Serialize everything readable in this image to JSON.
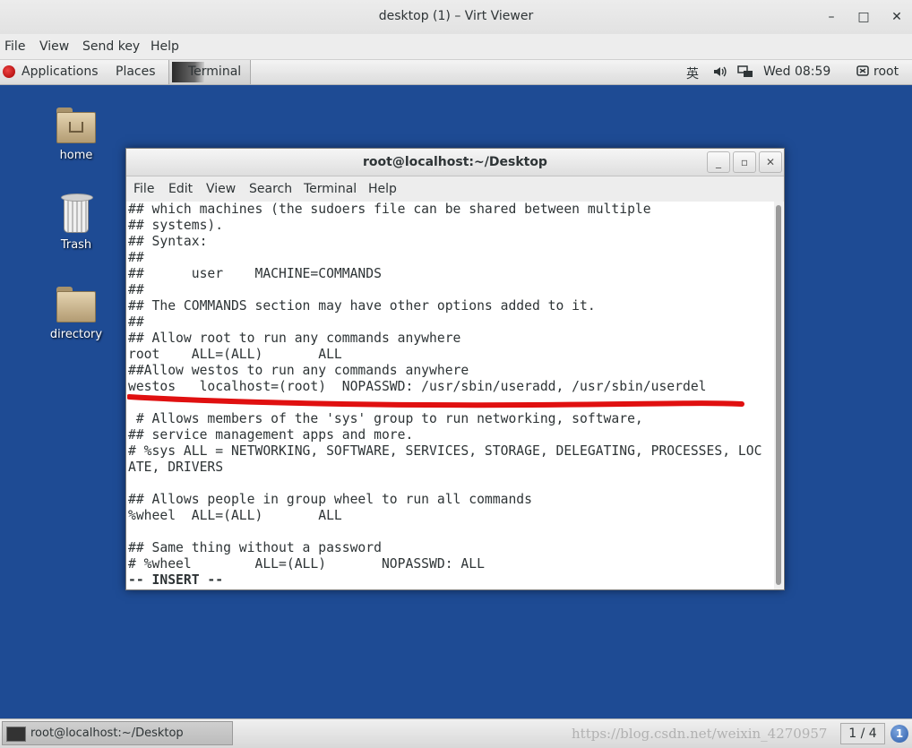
{
  "viewer": {
    "title": "desktop (1) – Virt Viewer",
    "controls": {
      "minimize": "–",
      "maximize": "□",
      "close": "✕"
    },
    "menu": [
      "File",
      "View",
      "Send key",
      "Help"
    ]
  },
  "top_panel": {
    "applications": "Applications",
    "places": "Places",
    "terminal": "Terminal",
    "input_method": "英",
    "volume_icon": "speaker-icon",
    "network_icon": "network-icon",
    "clock": "Wed 08:59",
    "user": "root"
  },
  "desktop": {
    "icons": [
      {
        "label": "home",
        "icon": "home-folder-icon"
      },
      {
        "label": "Trash",
        "icon": "trash-icon"
      },
      {
        "label": "directory",
        "icon": "folder-icon"
      }
    ]
  },
  "terminal": {
    "title": "root@localhost:~/Desktop",
    "controls": {
      "minimize": "_",
      "maximize": "▫",
      "close": "✕"
    },
    "menu": [
      "File",
      "Edit",
      "View",
      "Search",
      "Terminal",
      "Help"
    ],
    "lines": [
      "## which machines (the sudoers file can be shared between multiple",
      "## systems).",
      "## Syntax:",
      "##",
      "##      user    MACHINE=COMMANDS",
      "##",
      "## The COMMANDS section may have other options added to it.",
      "##",
      "## Allow root to run any commands anywhere",
      "root    ALL=(ALL)       ALL",
      "##Allow westos to run any commands anywhere",
      "westos   localhost=(root)  NOPASSWD: /usr/sbin/useradd, /usr/sbin/userdel",
      "",
      " # Allows members of the 'sys' group to run networking, software,",
      "## service management apps and more.",
      "# %sys ALL = NETWORKING, SOFTWARE, SERVICES, STORAGE, DELEGATING, PROCESSES, LOC",
      "ATE, DRIVERS",
      "",
      "## Allows people in group wheel to run all commands",
      "%wheel  ALL=(ALL)       ALL",
      "",
      "## Same thing without a password",
      "# %wheel        ALL=(ALL)       NOPASSWD: ALL",
      "-- INSERT --"
    ],
    "annotation_color": "#e01010"
  },
  "bottom_panel": {
    "task": "root@localhost:~/Desktop",
    "watermark": "https://blog.csdn.net/weixin_4270957",
    "workspace": "1 / 4",
    "notification_count": "1"
  }
}
